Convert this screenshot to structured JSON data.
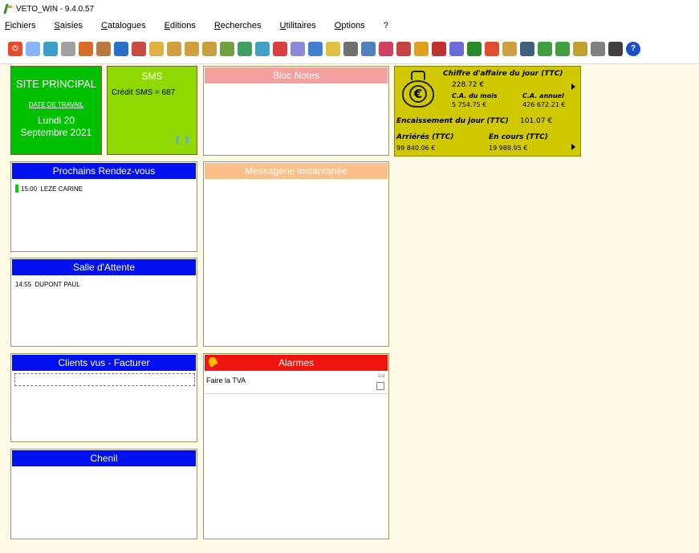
{
  "window": {
    "title": "VETO_WIN - 9.4.0.57"
  },
  "menu": {
    "items": [
      "Fichiers",
      "Saisies",
      "Catalogues",
      "Editions",
      "Recherches",
      "Utilitaires",
      "Options",
      "?"
    ]
  },
  "toolbar": {
    "buttons": [
      {
        "icon": "power-icon",
        "color": "#e84a2a"
      },
      {
        "icon": "pencil-icon",
        "color": "#8ab4f8"
      },
      {
        "icon": "register-icon",
        "color": "#3aa0c8"
      },
      {
        "icon": "refresh-icon",
        "color": "#a0a0a0"
      },
      {
        "icon": "people-icon",
        "color": "#d86a2a"
      },
      {
        "icon": "animal-icon",
        "color": "#b87a40"
      },
      {
        "icon": "globe-icon",
        "color": "#2a70c8"
      },
      {
        "icon": "book-icon",
        "color": "#c84a40"
      },
      {
        "icon": "bag-icon",
        "color": "#e0b040"
      },
      {
        "icon": "truck-icon",
        "color": "#d0a040"
      },
      {
        "icon": "truck2-icon",
        "color": "#d0a040"
      },
      {
        "icon": "document-icon",
        "color": "#c8a040"
      },
      {
        "icon": "note-icon",
        "color": "#70a040"
      },
      {
        "icon": "chart-icon",
        "color": "#40a060"
      },
      {
        "icon": "map-icon",
        "color": "#40a0c8"
      },
      {
        "icon": "cross-icon",
        "color": "#d84040"
      },
      {
        "icon": "box-icon",
        "color": "#8a8ad8"
      },
      {
        "icon": "mail-icon",
        "color": "#4080d0"
      },
      {
        "icon": "star-icon",
        "color": "#e0c040"
      },
      {
        "icon": "printer-icon",
        "color": "#707070"
      },
      {
        "icon": "graph-icon",
        "color": "#5080c0"
      },
      {
        "icon": "list-icon",
        "color": "#d04060"
      },
      {
        "icon": "car-icon",
        "color": "#c84040"
      },
      {
        "icon": "bars-icon",
        "color": "#e0a020"
      },
      {
        "icon": "heart-icon",
        "color": "#c03030"
      },
      {
        "icon": "ring-icon",
        "color": "#6a6ad8"
      },
      {
        "icon": "palette-icon",
        "color": "#2a8a2a"
      },
      {
        "icon": "home-icon",
        "color": "#e05030"
      },
      {
        "icon": "sign-icon",
        "color": "#d0a040"
      },
      {
        "icon": "window-icon",
        "color": "#406080"
      },
      {
        "icon": "leaf-icon",
        "color": "#40a040"
      },
      {
        "icon": "check-icon",
        "color": "#40a040"
      },
      {
        "icon": "brush-icon",
        "color": "#c0a030"
      },
      {
        "icon": "calendar-icon",
        "color": "#808080"
      },
      {
        "icon": "calculator-icon",
        "color": "#404040"
      },
      {
        "icon": "help-icon",
        "color": "#1850c8"
      }
    ]
  },
  "site": {
    "title": "SITE PRINCIPAL",
    "date_label": "DATE DE TRAVAIL",
    "date_line1": "Lundi 20",
    "date_line2": "Septembre 2021"
  },
  "sms": {
    "title": "SMS",
    "credit": "Crédit SMS = 687"
  },
  "bloc_notes": {
    "title": "Bloc Notes"
  },
  "finance": {
    "ca_jour_label": "Chiffre d'affaire du jour (TTC)",
    "ca_jour_value": "228.72 €",
    "ca_mois_label": "C.A. du mois",
    "ca_mois_value": "5 754.75 €",
    "ca_annuel_label": "C.A. annuel",
    "ca_annuel_value": "426 672.21 €",
    "encaissement_label": "Encaissement du jour (TTC)",
    "encaissement_value": "101.07 €",
    "arrieres_label": "Arriérés (TTC)",
    "arrieres_value": "99 840.06 €",
    "en_cours_label": "En cours (TTC)",
    "en_cours_value": "19 989.95 €"
  },
  "rdv": {
    "title": "Prochains Rendez-vous",
    "items": [
      {
        "time": "15:00",
        "name": "LEZE CARINE",
        "status_color": "#00d000"
      }
    ]
  },
  "messagerie": {
    "title": "Messagerie instantanée"
  },
  "salle_attente": {
    "title": "Salle d'Attente",
    "items": [
      {
        "time": "14:55",
        "name": "DUPONT PAUL"
      }
    ]
  },
  "clients": {
    "title": "Clients vus - Facturer"
  },
  "alarmes": {
    "title": "Alarmes",
    "items": [
      {
        "text": "Faire la TVA",
        "lu_label": "Lu"
      }
    ]
  },
  "chenil": {
    "title": "Chenil"
  }
}
